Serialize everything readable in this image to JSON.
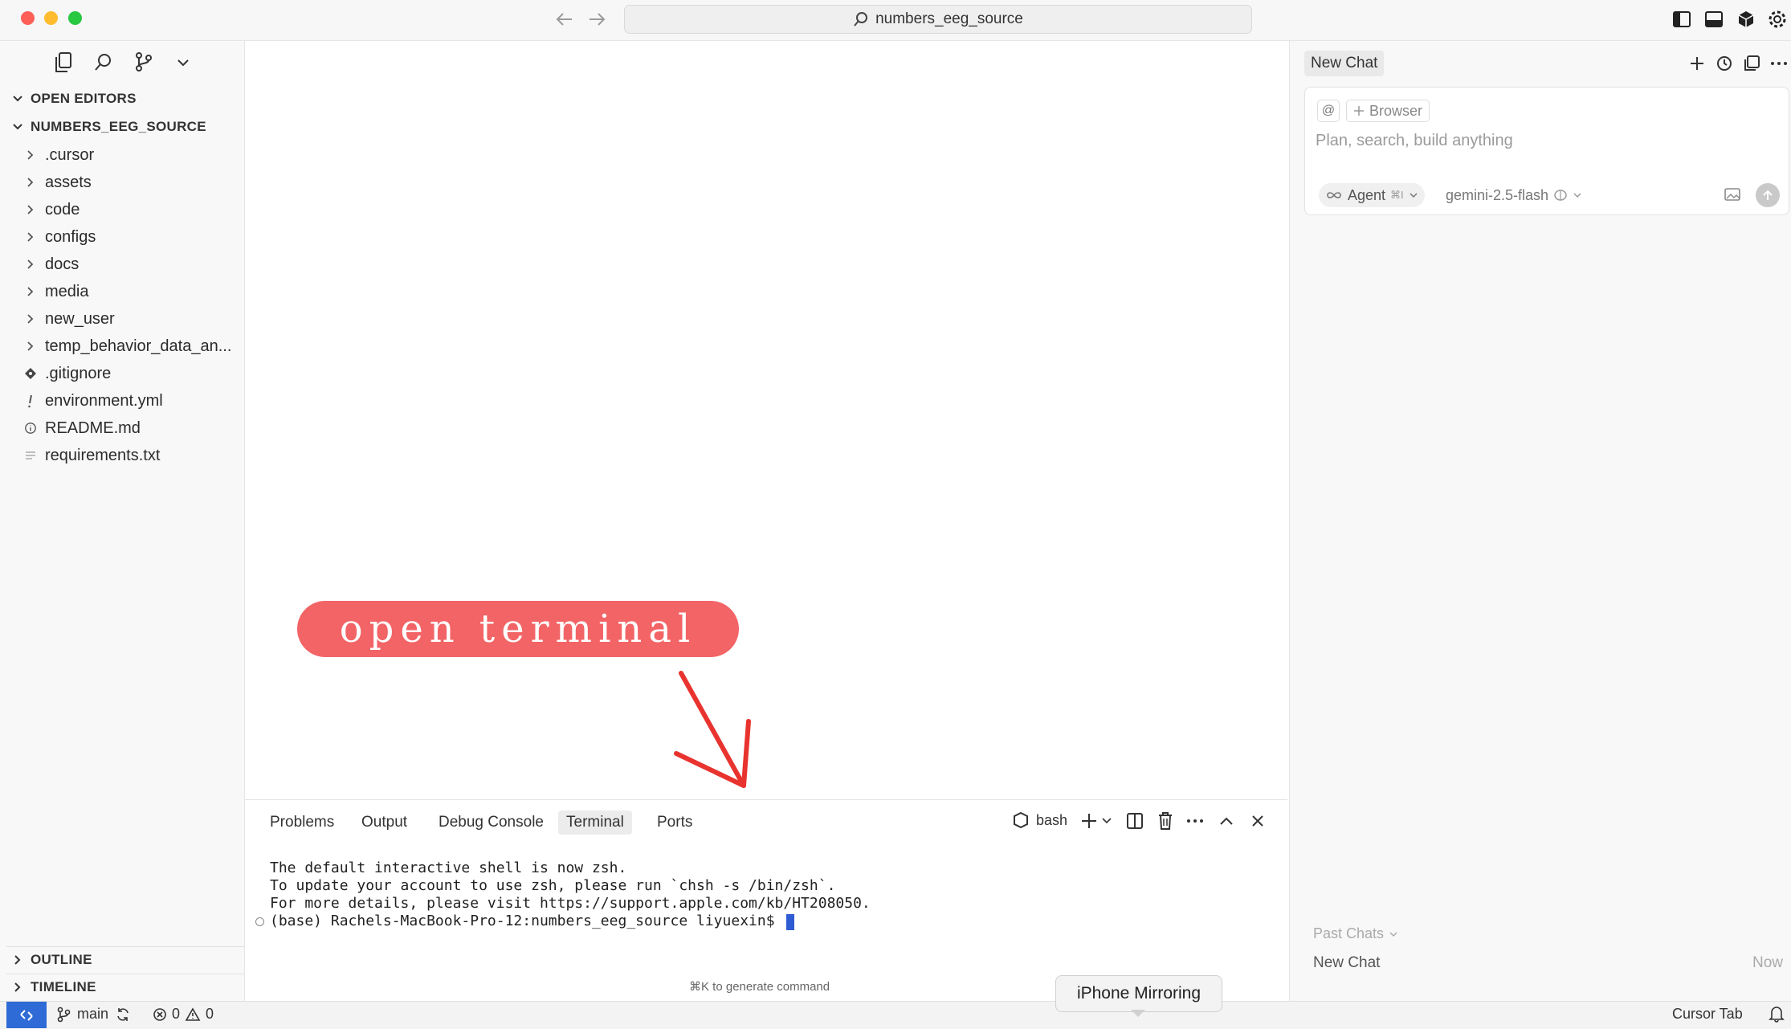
{
  "title_bar": {
    "search_label": "numbers_eeg_source"
  },
  "colors": {
    "close": "#fe5f57",
    "minimize": "#febc2e",
    "zoom": "#28c840",
    "annotation": "#f26466",
    "arrow": "#e8332f",
    "cursor": "#2f5bd3"
  },
  "sidebar": {
    "open_editors": "OPEN EDITORS",
    "project": "NUMBERS_EEG_SOURCE",
    "items": [
      {
        "label": ".cursor",
        "type": "folder"
      },
      {
        "label": "assets",
        "type": "folder"
      },
      {
        "label": "code",
        "type": "folder"
      },
      {
        "label": "configs",
        "type": "folder"
      },
      {
        "label": "docs",
        "type": "folder"
      },
      {
        "label": "media",
        "type": "folder"
      },
      {
        "label": "new_user",
        "type": "folder"
      },
      {
        "label": "temp_behavior_data_an...",
        "type": "folder"
      },
      {
        "label": ".gitignore",
        "type": "file",
        "icon": "git-diamond-icon"
      },
      {
        "label": "environment.yml",
        "type": "file",
        "icon": "exclamation-icon"
      },
      {
        "label": "README.md",
        "type": "file",
        "icon": "info-icon"
      },
      {
        "label": "requirements.txt",
        "type": "file",
        "icon": "lines-icon"
      }
    ],
    "outline": "OUTLINE",
    "timeline": "TIMELINE"
  },
  "annotation": {
    "text": "open terminal"
  },
  "panel": {
    "tabs": [
      "Problems",
      "Output",
      "Debug Console",
      "Terminal",
      "Ports"
    ],
    "active_tab": "Terminal",
    "shell": "bash",
    "terminal_lines": [
      "The default interactive shell is now zsh.",
      "To update your account to use zsh, please run `chsh -s /bin/zsh`.",
      "For more details, please visit https://support.apple.com/kb/HT208050."
    ],
    "prompt": "(base) Rachels-MacBook-Pro-12:numbers_eeg_source liyuexin$ ",
    "hint": "⌘K to generate command"
  },
  "chat": {
    "title": "New Chat",
    "at_symbol": "@",
    "browser_chip": "Browser",
    "placeholder": "Plan, search, build anything",
    "agent_label": "Agent",
    "agent_shortcut": "⌘I",
    "model": "gemini-2.5-flash",
    "past_chats": "Past Chats",
    "history": [
      {
        "name": "New Chat",
        "time": "Now"
      }
    ]
  },
  "tooltip": "iPhone Mirroring",
  "status_bar": {
    "branch": "main",
    "errors": "0",
    "warnings": "0",
    "right_label": "Cursor Tab"
  }
}
